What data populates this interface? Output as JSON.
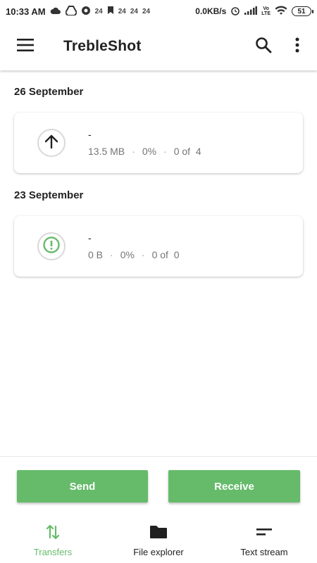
{
  "status_bar": {
    "time": "10:33 AM",
    "notif_counts": [
      "24",
      "24",
      "24",
      "24"
    ],
    "net_speed": "0.0KB/s",
    "volte_top": "Vo",
    "volte_bottom": "LTE",
    "battery": "51"
  },
  "app_bar": {
    "title": "TrebleShot",
    "icons": [
      "menu-icon",
      "search-icon",
      "more-vert-icon"
    ]
  },
  "transfers": [
    {
      "date": "26 September",
      "name": "-",
      "size": "13.5 MB",
      "progress": "0%",
      "count": "0 of  4",
      "direction": "outgoing",
      "icon": "arrow-up-icon"
    },
    {
      "date": "23 September",
      "name": "-",
      "size": "0 B",
      "progress": "0%",
      "count": "0 of  0",
      "direction": "incoming",
      "icon": "alert-circle-icon"
    }
  ],
  "actions": {
    "send_label": "Send",
    "receive_label": "Receive"
  },
  "bottom_nav": {
    "items": [
      {
        "label": "Transfers",
        "icon": "swap-vert-icon",
        "active": true
      },
      {
        "label": "File explorer",
        "icon": "folder-icon",
        "active": false
      },
      {
        "label": "Text stream",
        "icon": "short-text-icon",
        "active": false
      }
    ]
  },
  "colors": {
    "accent": "#66bb6a",
    "text_primary": "#212121",
    "text_secondary": "#757575"
  }
}
